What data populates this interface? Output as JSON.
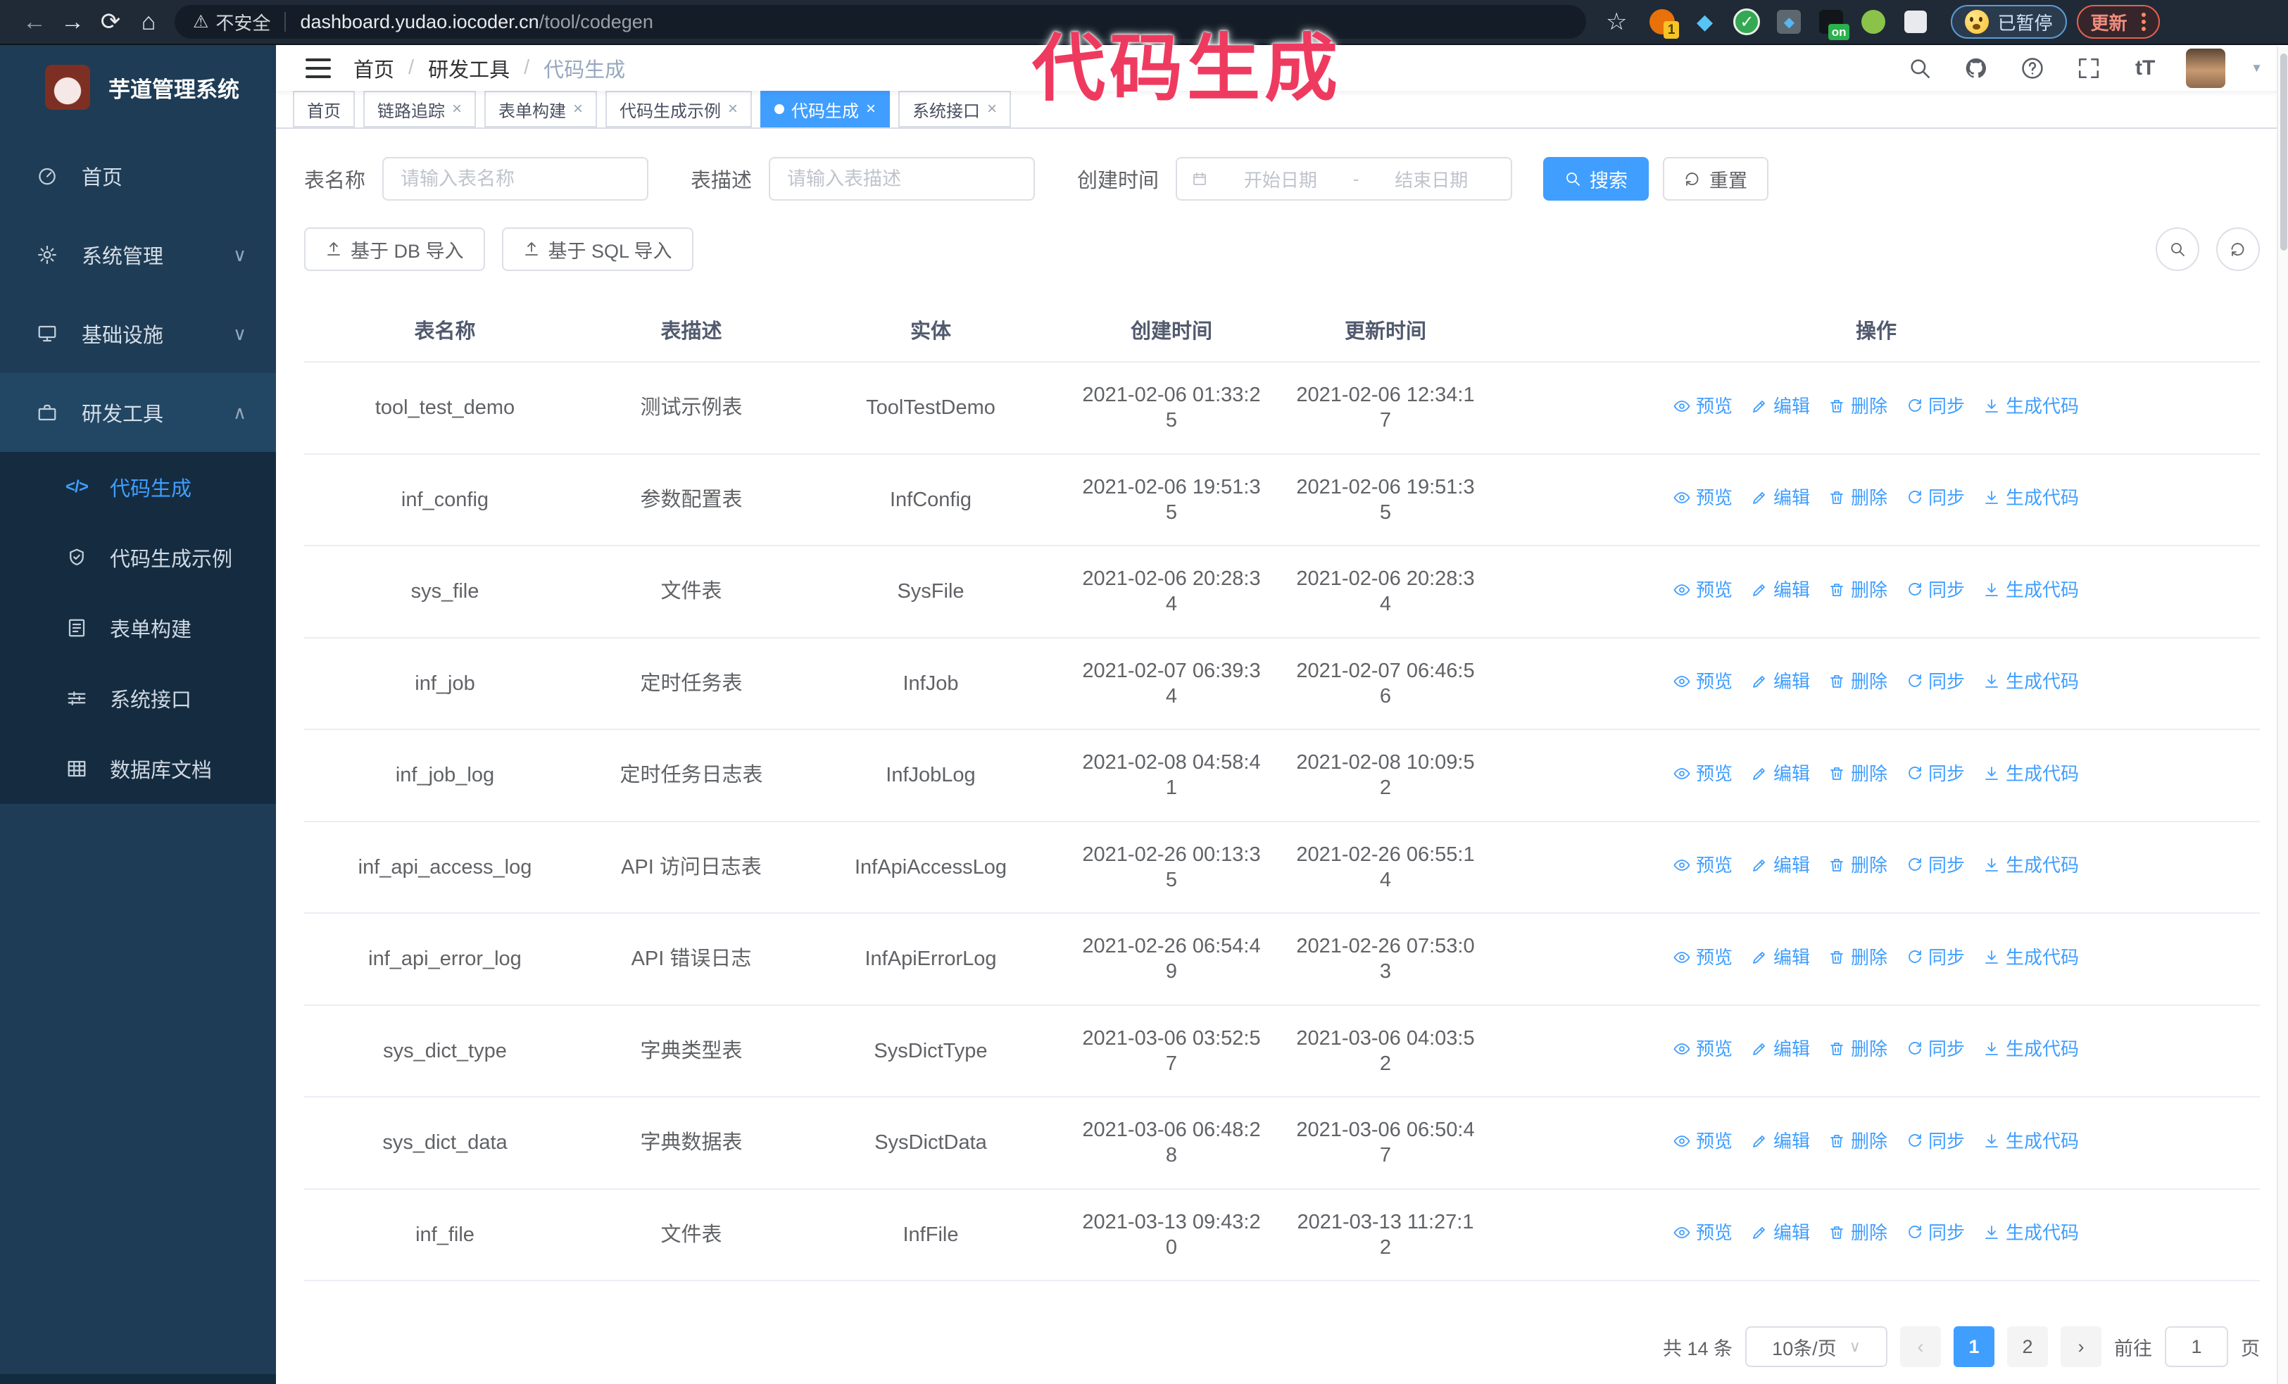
{
  "browser": {
    "security_label": "不安全",
    "url_host": "dashboard.yudao.iocoder.cn",
    "url_path": "/tool/codegen",
    "extension_badge_count": "1",
    "extension_badge_on": "on",
    "paused_label": "已暂停",
    "update_label": "更新"
  },
  "annotation": {
    "text": "代码生成",
    "color": "#ef3a60"
  },
  "sidebar": {
    "title": "芋道管理系统",
    "items": [
      {
        "label": "首页"
      },
      {
        "label": "系统管理"
      },
      {
        "label": "基础设施"
      },
      {
        "label": "研发工具"
      }
    ],
    "submenu": [
      {
        "label": "代码生成"
      },
      {
        "label": "代码生成示例"
      },
      {
        "label": "表单构建"
      },
      {
        "label": "系统接口"
      },
      {
        "label": "数据库文档"
      }
    ]
  },
  "breadcrumb": {
    "items": [
      "首页",
      "研发工具",
      "代码生成"
    ]
  },
  "tabs": {
    "items": [
      {
        "label": "首页"
      },
      {
        "label": "链路追踪"
      },
      {
        "label": "表单构建"
      },
      {
        "label": "代码生成示例"
      },
      {
        "label": "代码生成"
      },
      {
        "label": "系统接口"
      }
    ]
  },
  "filters": {
    "table_name_label": "表名称",
    "table_name_placeholder": "请输入表名称",
    "table_desc_label": "表描述",
    "table_desc_placeholder": "请输入表描述",
    "create_time_label": "创建时间",
    "start_date_placeholder": "开始日期",
    "range_separator": "-",
    "end_date_placeholder": "结束日期",
    "search_label": "搜索",
    "reset_label": "重置"
  },
  "toolbar": {
    "import_db_label": "基于 DB 导入",
    "import_sql_label": "基于 SQL 导入"
  },
  "table": {
    "columns": [
      "表名称",
      "表描述",
      "实体",
      "创建时间",
      "更新时间",
      "操作"
    ],
    "actions": {
      "preview": "预览",
      "edit": "编辑",
      "delete": "删除",
      "sync": "同步",
      "generate": "生成代码"
    },
    "rows": [
      {
        "name": "tool_test_demo",
        "desc": "测试示例表",
        "entity": "ToolTestDemo",
        "created": "2021-02-06 01:33:25",
        "updated": "2021-02-06 12:34:17"
      },
      {
        "name": "inf_config",
        "desc": "参数配置表",
        "entity": "InfConfig",
        "created": "2021-02-06 19:51:35",
        "updated": "2021-02-06 19:51:35"
      },
      {
        "name": "sys_file",
        "desc": "文件表",
        "entity": "SysFile",
        "created": "2021-02-06 20:28:34",
        "updated": "2021-02-06 20:28:34"
      },
      {
        "name": "inf_job",
        "desc": "定时任务表",
        "entity": "InfJob",
        "created": "2021-02-07 06:39:34",
        "updated": "2021-02-07 06:46:56"
      },
      {
        "name": "inf_job_log",
        "desc": "定时任务日志表",
        "entity": "InfJobLog",
        "created": "2021-02-08 04:58:41",
        "updated": "2021-02-08 10:09:52"
      },
      {
        "name": "inf_api_access_log",
        "desc": "API 访问日志表",
        "entity": "InfApiAccessLog",
        "created": "2021-02-26 00:13:35",
        "updated": "2021-02-26 06:55:14"
      },
      {
        "name": "inf_api_error_log",
        "desc": "API 错误日志",
        "entity": "InfApiErrorLog",
        "created": "2021-02-26 06:54:49",
        "updated": "2021-02-26 07:53:03"
      },
      {
        "name": "sys_dict_type",
        "desc": "字典类型表",
        "entity": "SysDictType",
        "created": "2021-03-06 03:52:57",
        "updated": "2021-03-06 04:03:52"
      },
      {
        "name": "sys_dict_data",
        "desc": "字典数据表",
        "entity": "SysDictData",
        "created": "2021-03-06 06:48:28",
        "updated": "2021-03-06 06:50:47"
      },
      {
        "name": "inf_file",
        "desc": "文件表",
        "entity": "InfFile",
        "created": "2021-03-13 09:43:20",
        "updated": "2021-03-13 11:27:12"
      }
    ]
  },
  "pagination": {
    "total_text": "共 14 条",
    "page_size_text": "10条/页",
    "page_1": "1",
    "page_2": "2",
    "goto_label": "前往",
    "goto_value": "1",
    "goto_unit": "页"
  },
  "icons": {
    "back": "←",
    "forward": "→",
    "reload": "⟳",
    "home": "⌂",
    "warning": "⚠",
    "star": "☆",
    "gem": "◆",
    "check": "✓",
    "close": "×",
    "caret_down": "▼",
    "chevron_down": "∨",
    "chevron_up": "∧",
    "prev_page": "‹",
    "next_page": "›",
    "font_size": "tT",
    "code": "</>"
  },
  "colors": {
    "primary": "#409eff",
    "annotation": "#ef3a60",
    "sidebar_bg": "#1e3c55",
    "submenu_bg": "#152c40"
  }
}
